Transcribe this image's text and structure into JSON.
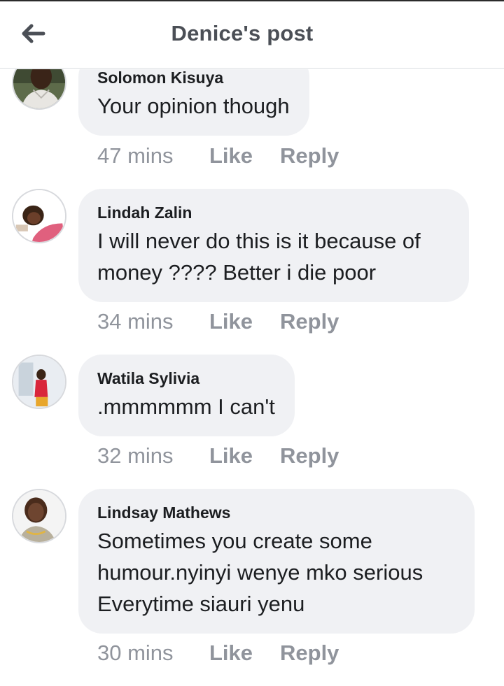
{
  "header": {
    "title": "Denice's post",
    "back_icon": "arrow-left-icon"
  },
  "colors": {
    "bubble": "#f0f1f4",
    "meta_text": "#90949c",
    "title_text": "#4b4f56"
  },
  "actions": {
    "like_label": "Like",
    "reply_label": "Reply"
  },
  "comments": [
    {
      "author": "Solomon Kisuya",
      "lines": [
        "Your opinion though"
      ],
      "time": "47 mins"
    },
    {
      "author": "Lindah Zalin",
      "lines": [
        "I will never do this is it because of",
        "money ???? Better i die poor"
      ],
      "time": "34 mins"
    },
    {
      "author": "Watila Sylivia",
      "lines": [
        ".mmmmmm I can't"
      ],
      "time": "32 mins"
    },
    {
      "author": "Lindsay Mathews",
      "lines": [
        "Sometimes you create some",
        "humour.nyinyi wenye mko serious",
        "Everytime siauri yenu"
      ],
      "time": "30 mins"
    }
  ]
}
